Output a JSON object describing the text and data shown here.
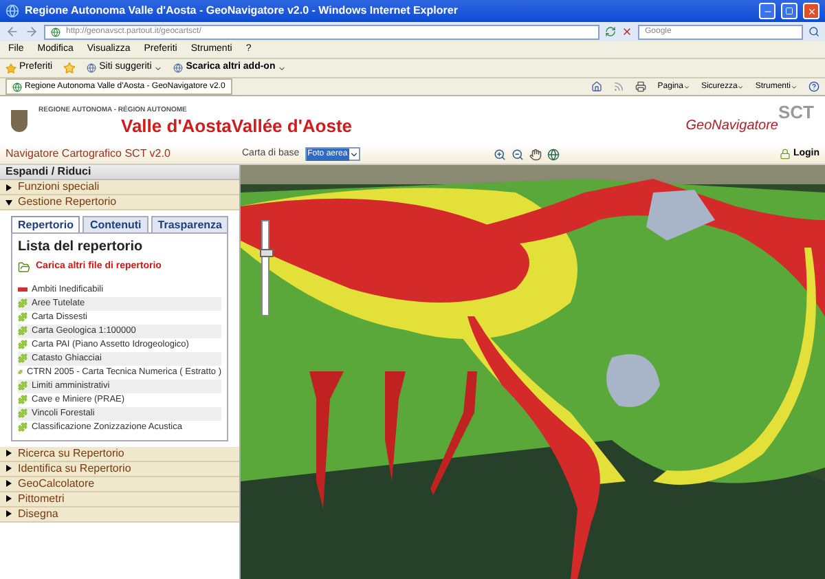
{
  "window": {
    "title": "Regione Autonoma Valle d'Aosta - GeoNavigatore v2.0 - Windows Internet Explorer"
  },
  "address_bar": {
    "url": "http://geonavsct.partout.it/geocartsct/"
  },
  "search": {
    "placeholder": "Google"
  },
  "menu": [
    "File",
    "Modifica",
    "Visualizza",
    "Preferiti",
    "Strumenti",
    "?"
  ],
  "favorites_bar": {
    "favorites": "Preferiti",
    "items": [
      "Siti suggeriti",
      "Scarica altri add-on"
    ]
  },
  "browser_tab": {
    "title": "Regione Autonoma Valle d'Aosta - GeoNavigatore v2.0"
  },
  "command_bar": [
    "Pagina",
    "Sicurezza",
    "Strumenti"
  ],
  "header": {
    "region": "REGIONE AUTONOMA - RÉGION AUTONOME",
    "logo_it": "Valle d'Aosta",
    "logo_fr": "Vallée d'Aoste",
    "app": "GeoNavigatore",
    "brand": "SCT"
  },
  "toolbar": {
    "title": "Navigatore Cartografico SCT v2.0",
    "base_map_label": "Carta di base",
    "base_map_value": "Foto aerea",
    "login": "Login"
  },
  "sidebar": {
    "header": "Espandi / Riduci",
    "sections": [
      {
        "label": "Funzioni speciali",
        "expanded": false
      },
      {
        "label": "Gestione Repertorio",
        "expanded": true,
        "tabs": [
          {
            "label": "Repertorio",
            "selected": true
          },
          {
            "label": "Contenuti",
            "selected": false
          },
          {
            "label": "Trasparenza",
            "selected": false
          }
        ],
        "list_title": "Lista del repertorio",
        "load_link": "Carica altri file di repertorio",
        "layers": [
          {
            "kind": "line",
            "label": "Ambiti Inedificabili"
          },
          {
            "kind": "layer",
            "label": "Aree Tutelate"
          },
          {
            "kind": "layer",
            "label": "Carta Dissesti"
          },
          {
            "kind": "layer",
            "label": "Carta Geologica 1:100000"
          },
          {
            "kind": "layer",
            "label": "Carta PAI (Piano Assetto Idrogeologico)"
          },
          {
            "kind": "layer",
            "label": "Catasto Ghiacciai"
          },
          {
            "kind": "layer",
            "label": "CTRN 2005 - Carta Tecnica Numerica ( Estratto )"
          },
          {
            "kind": "layer",
            "label": "Limiti amministrativi"
          },
          {
            "kind": "layer",
            "label": "Cave e Miniere (PRAE)"
          },
          {
            "kind": "layer",
            "label": "Vincoli Forestali"
          },
          {
            "kind": "layer",
            "label": "Classificazione Zonizzazione Acustica"
          }
        ]
      },
      {
        "label": "Ricerca su Repertorio",
        "expanded": false
      },
      {
        "label": "Identifica su Repertorio",
        "expanded": false
      },
      {
        "label": "GeoCalcolatore",
        "expanded": false
      },
      {
        "label": "Pittometri",
        "expanded": false
      },
      {
        "label": "Disegna",
        "expanded": false
      }
    ]
  },
  "map": {
    "zoom": {
      "level": 0.62
    }
  }
}
